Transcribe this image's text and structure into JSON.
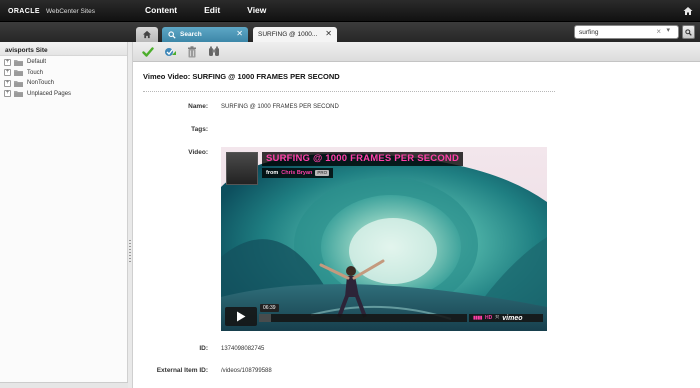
{
  "topbar": {
    "brand_oracle": "ORACLE",
    "brand_product": "WebCenter Sites",
    "menu": [
      "Content",
      "Edit",
      "View"
    ]
  },
  "tabs": {
    "search_label": "Search",
    "active_label": "SURFING @ 1000..."
  },
  "search": {
    "value": "surfing"
  },
  "sidebar": {
    "site_title": "avisports Site",
    "items": [
      "Default",
      "Touch",
      "NonTouch",
      "Unplaced Pages"
    ]
  },
  "toolbar": {
    "icons": [
      "checkmark-icon",
      "approve-icon",
      "delete-icon",
      "binoculars-icon"
    ]
  },
  "content": {
    "title": "Vimeo Video: SURFING @ 1000 FRAMES PER SECOND",
    "fields": {
      "name_label": "Name:",
      "name_value": "SURFING @ 1000 FRAMES PER SECOND",
      "tags_label": "Tags:",
      "video_label": "Video:",
      "id_label": "ID:",
      "id_value": "1374098082745",
      "external_label": "External Item ID:",
      "external_value": "/videos/108799588"
    }
  },
  "video": {
    "title": "SURFING @ 1000 FRAMES PER SECOND",
    "from": "from",
    "author": "Chris Bryan",
    "badge": "PRO",
    "time": "06:39",
    "hd": "HD",
    "logo": "vimeo",
    "progress": 0.06
  },
  "colors": {
    "accent_pink": "#ff3fa8",
    "tab_search": "#4a93b4",
    "topbar": "#1c1c1c"
  }
}
